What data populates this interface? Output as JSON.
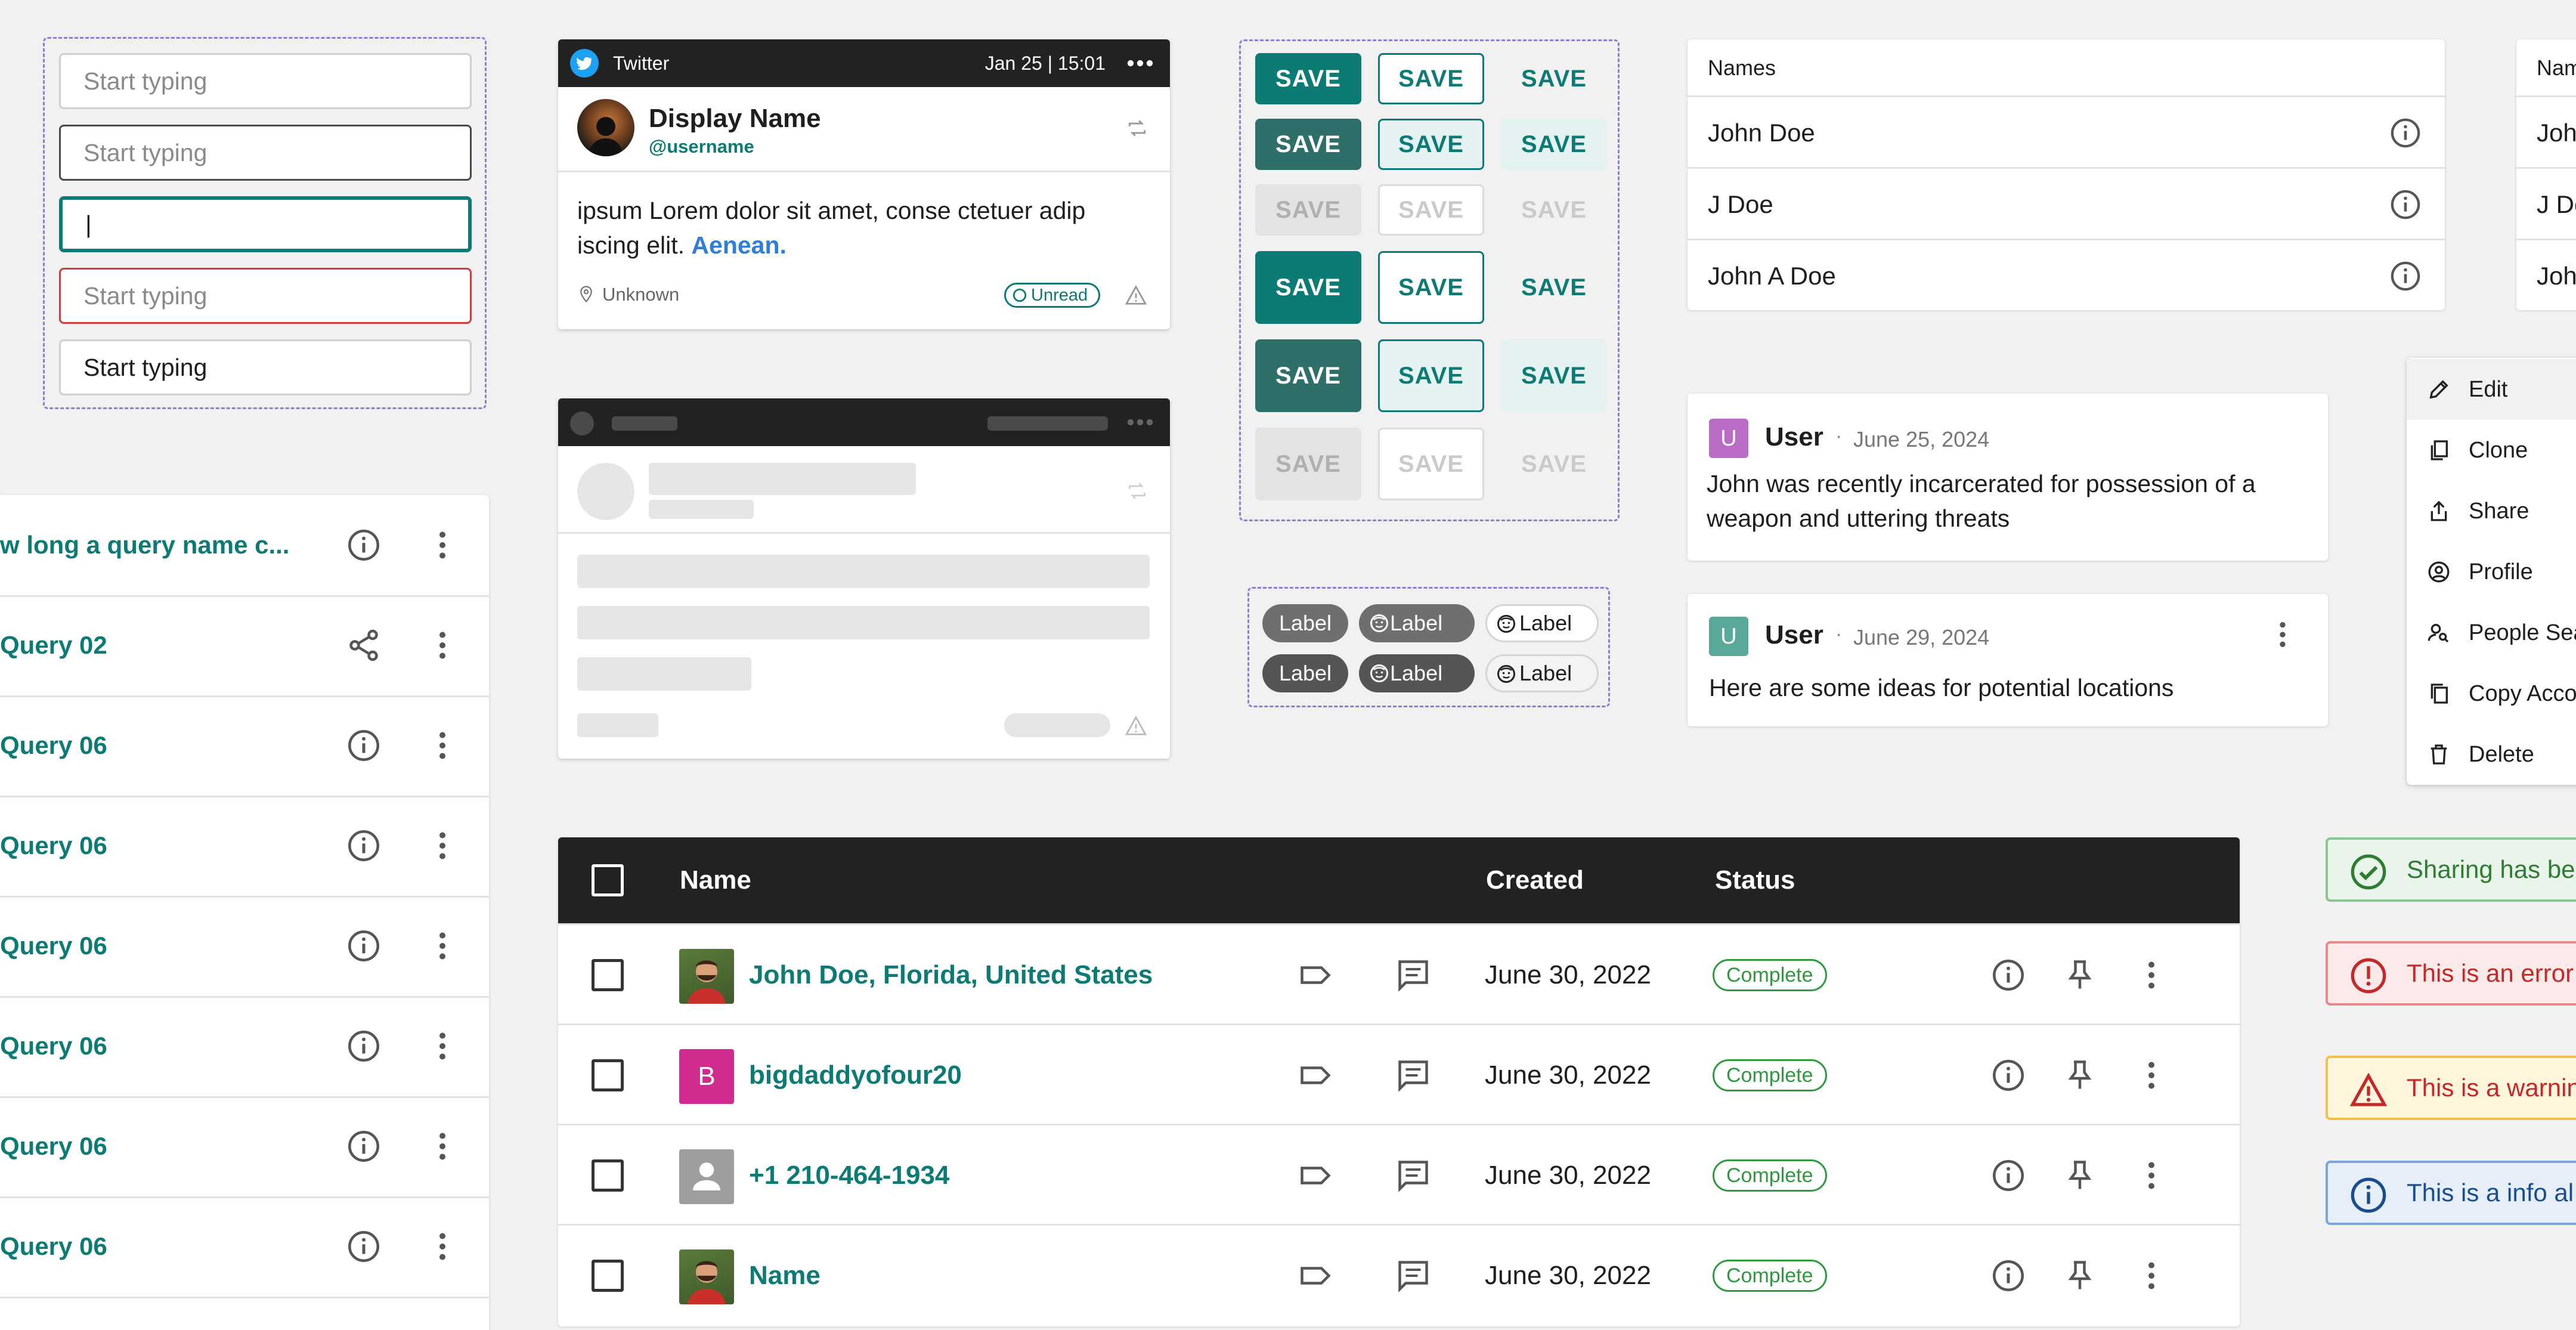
{
  "inputs": [
    {
      "placeholder": "Start typing",
      "value": "",
      "state": "default"
    },
    {
      "placeholder": "Start typing",
      "value": "",
      "state": "hover"
    },
    {
      "placeholder": "",
      "value": "|",
      "state": "focus"
    },
    {
      "placeholder": "Start typing",
      "value": "",
      "state": "error"
    },
    {
      "placeholder": "",
      "value": "Start typing",
      "state": "filled"
    }
  ],
  "queries": [
    {
      "name": "w long a query name c...",
      "icon": "info-icon"
    },
    {
      "name": "Query 02",
      "icon": "share-icon"
    },
    {
      "name": "Query 06",
      "icon": "info-icon"
    },
    {
      "name": "Query 06",
      "icon": "info-icon"
    },
    {
      "name": "Query 06",
      "icon": "info-icon"
    },
    {
      "name": "Query 06",
      "icon": "info-icon"
    },
    {
      "name": "Query 06",
      "icon": "info-icon"
    },
    {
      "name": "Query 06",
      "icon": "info-icon"
    }
  ],
  "tweet": {
    "source": "Twitter",
    "datetime": "Jan 25 | 15:01",
    "display_name": "Display Name",
    "username": "@username",
    "body": "ipsum Lorem dolor sit amet, conse ctetuer adip iscing elit.",
    "link": "Aenean.",
    "location": "Unknown",
    "badge": "Unread"
  },
  "save_label": "SAVE",
  "chip_label": "Label",
  "names_table": {
    "header": "Names",
    "rows": [
      "John Doe",
      "J Doe",
      "John A Doe"
    ],
    "header2": "Nam",
    "rows2": [
      "Joh",
      "J Do",
      "Joh"
    ]
  },
  "comments": [
    {
      "initial": "U",
      "user": "User",
      "date": "June 25, 2024",
      "text": "John was recently incarcerated for possession of a weapon and uttering threats",
      "color": "#b86cc4"
    },
    {
      "initial": "U",
      "user": "User",
      "date": "June 29, 2024",
      "text": "Here are some ideas for potential locations",
      "color": "#5aa89a"
    }
  ],
  "context_menu": [
    {
      "label": "Edit",
      "icon": "pencil-icon"
    },
    {
      "label": "Clone",
      "icon": "clone-icon"
    },
    {
      "label": "Share",
      "icon": "share-upload-icon"
    },
    {
      "label": "Profile",
      "icon": "profile-icon"
    },
    {
      "label": "People Sea",
      "icon": "people-search-icon"
    },
    {
      "label": "Copy Acco",
      "icon": "copy-icon"
    },
    {
      "label": "Delete",
      "icon": "trash-icon"
    }
  ],
  "table": {
    "headers": {
      "name": "Name",
      "created": "Created",
      "status": "Status"
    },
    "rows": [
      {
        "name": "John Doe, Florida, United States",
        "avatar": "photo",
        "date": "June 30, 2022",
        "status": "Complete"
      },
      {
        "name": "bigdaddyofour20",
        "avatar": "B",
        "date": "June 30, 2022",
        "status": "Complete"
      },
      {
        "name": "+1 210-464-1934",
        "avatar": "person",
        "date": "June 30, 2022",
        "status": "Complete"
      },
      {
        "name": "Name",
        "avatar": "photo",
        "date": "June 30, 2022",
        "status": "Complete"
      }
    ]
  },
  "alerts": [
    {
      "type": "success",
      "text": "Sharing has be",
      "color": "#2e7d32"
    },
    {
      "type": "error",
      "text": "This is an error",
      "color": "#c62828"
    },
    {
      "type": "warning",
      "text": "This is a warnin",
      "color": "#c62828"
    },
    {
      "type": "info",
      "text": "This is a info al",
      "color": "#1a4d8f"
    }
  ],
  "colors": {
    "teal": "#0c7b73",
    "dark_teal": "#2f6f69",
    "link_blue": "#2f7ed8",
    "twitter": "#1da1f2"
  }
}
